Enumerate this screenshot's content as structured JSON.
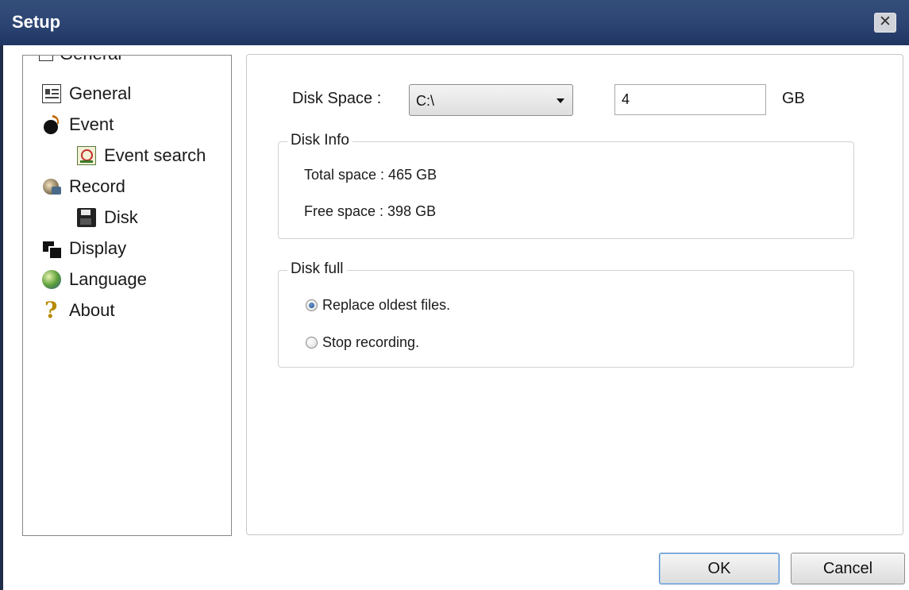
{
  "window": {
    "title": "Setup",
    "close_label": "✕"
  },
  "tree": {
    "scrolled_item": "General",
    "items": [
      {
        "label": "General",
        "icon": "general-icon"
      },
      {
        "label": "Event",
        "icon": "event-icon"
      },
      {
        "label": "Event search",
        "icon": "event-search-icon"
      },
      {
        "label": "Record",
        "icon": "record-icon"
      },
      {
        "label": "Disk",
        "icon": "disk-icon"
      },
      {
        "label": "Display",
        "icon": "display-icon"
      },
      {
        "label": "Language",
        "icon": "language-icon"
      },
      {
        "label": "About",
        "icon": "about-icon"
      }
    ],
    "selected": "Disk"
  },
  "disk": {
    "space_label": "Disk Space :",
    "drive_value": "C:\\",
    "size_value": "4",
    "unit": "GB"
  },
  "disk_info": {
    "legend": "Disk Info",
    "total": "Total space : 465 GB",
    "free": "Free space : 398 GB"
  },
  "disk_full": {
    "legend": "Disk full",
    "options": [
      {
        "label": "Replace oldest files.",
        "checked": true
      },
      {
        "label": "Stop recording.",
        "checked": false
      }
    ]
  },
  "buttons": {
    "ok": "OK",
    "cancel": "Cancel"
  }
}
